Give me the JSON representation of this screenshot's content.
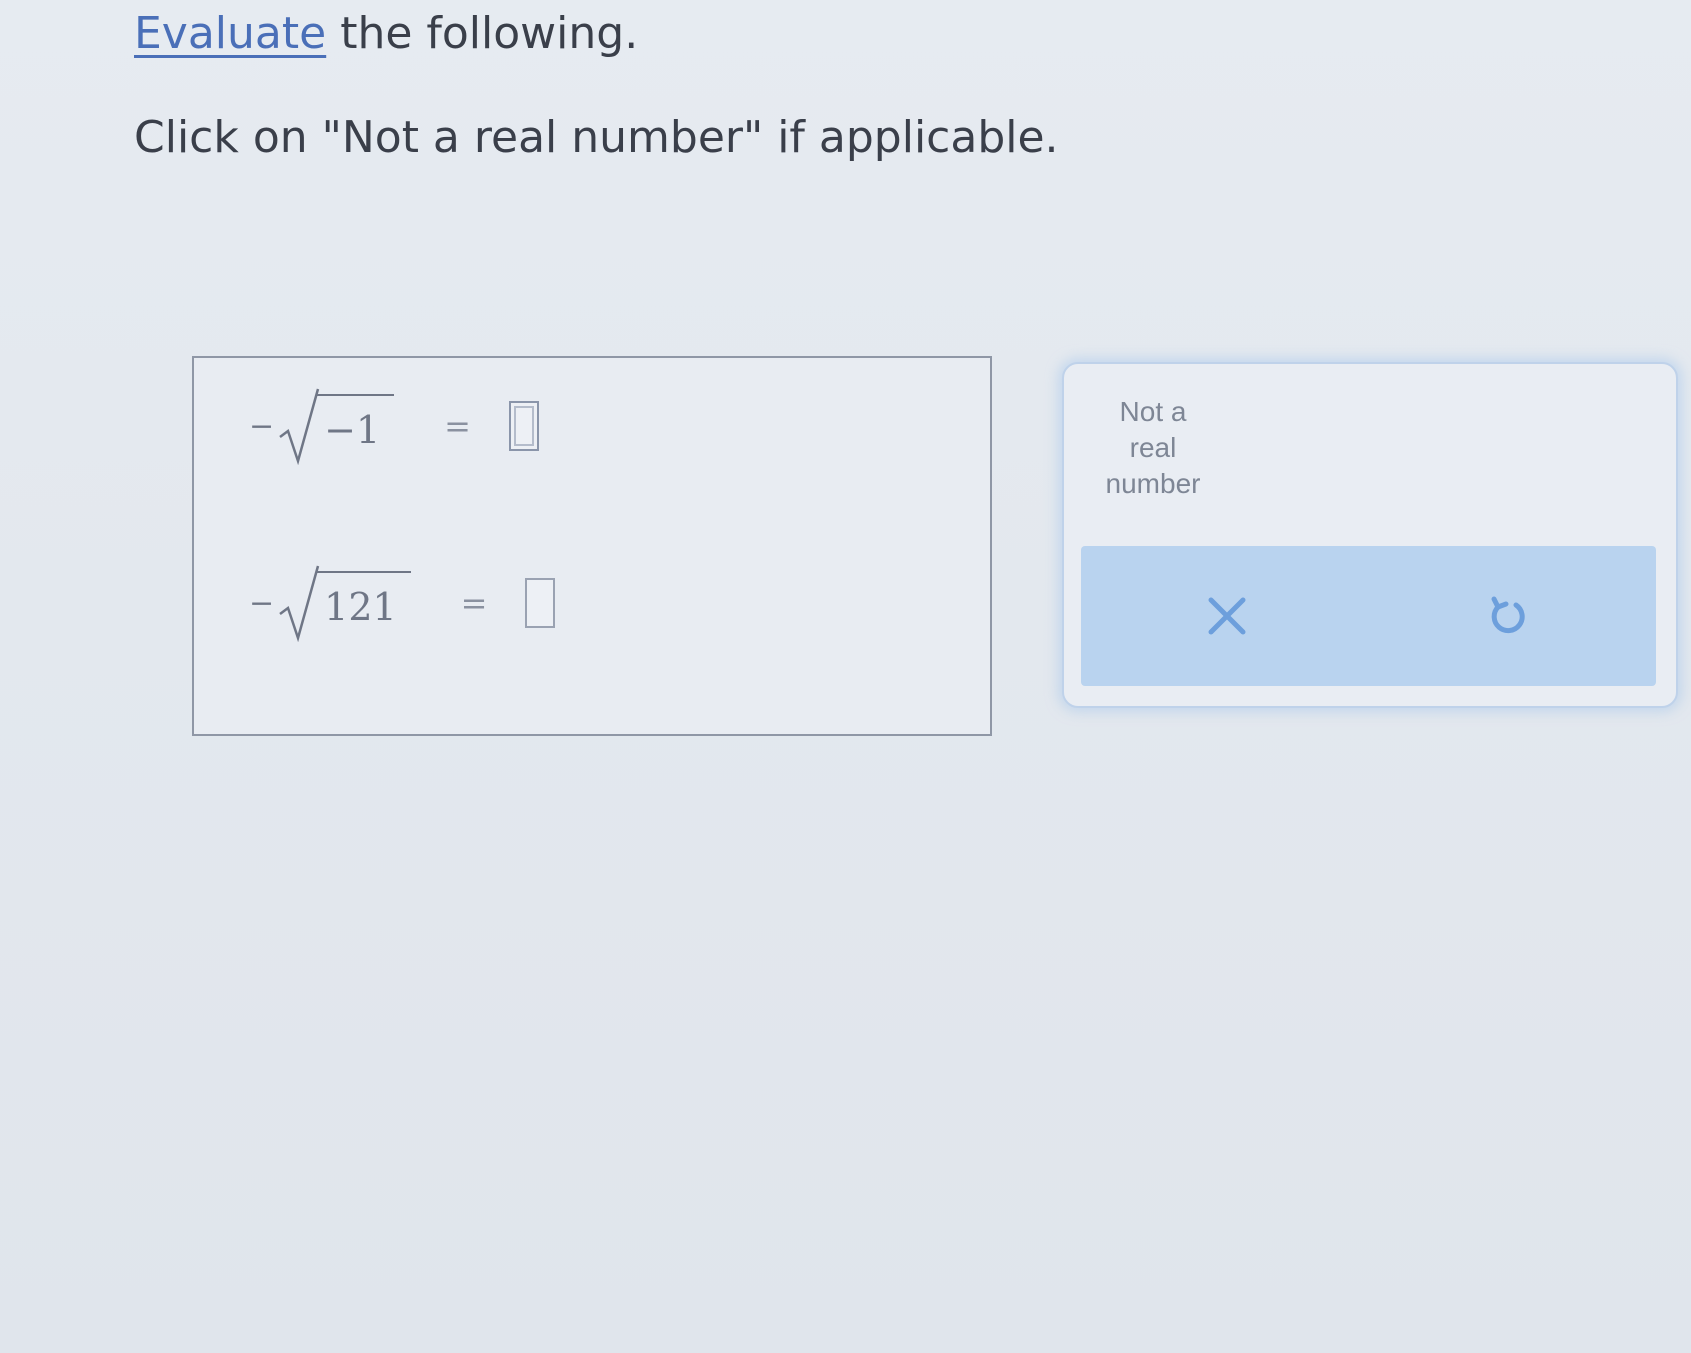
{
  "instructions": {
    "line1_link": "Evaluate",
    "line1_rest": " the following.",
    "line2": "Click on \"Not a real number\" if applicable."
  },
  "problems": [
    {
      "sign": "−",
      "radicand": "−1",
      "equals": "="
    },
    {
      "sign": "−",
      "radicand": "121",
      "equals": "="
    }
  ],
  "tools": {
    "not_real_number_label": "Not a real number",
    "not_real_line1": "Not a",
    "not_real_line2": "real",
    "not_real_line3": "number",
    "clear_icon": "x-icon",
    "undo_icon": "undo-icon"
  },
  "colors": {
    "link": "#4a6fb8",
    "action_bar": "#b9d3ef",
    "icon": "#6d9fdc"
  }
}
